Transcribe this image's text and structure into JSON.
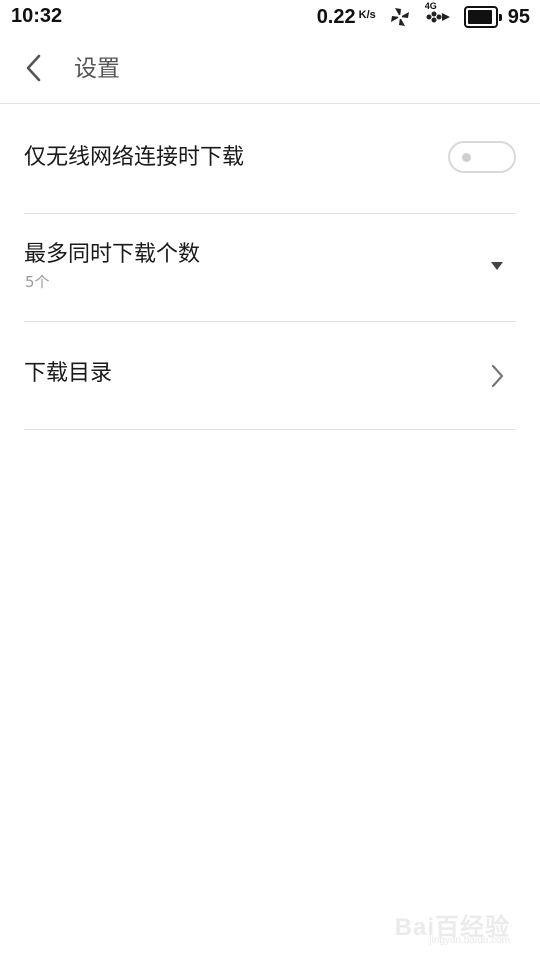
{
  "status_bar": {
    "time": "10:32",
    "net_speed": "0.22",
    "net_unit": "K/s",
    "network_type": "4G",
    "battery_level": "95",
    "battery_percent": 95,
    "icons": [
      "pinwheel-icon",
      "signal-4g-icon",
      "battery-icon"
    ]
  },
  "header": {
    "back_icon": "chevron-left-icon",
    "title": "设置"
  },
  "settings": [
    {
      "title": "仅无线网络连接时下载",
      "control": "toggle",
      "enabled": false
    },
    {
      "title": "最多同时下载个数",
      "subtitle": "5个",
      "control": "dropdown",
      "icon": "dropdown-triangle-icon"
    },
    {
      "title": "下载目录",
      "control": "chevron",
      "icon": "chevron-right-icon"
    }
  ],
  "watermark": {
    "text": "Bai百经验",
    "sub": "jingyan.baidu.com"
  },
  "colors": {
    "background": "#ffffff",
    "divider": "#e3e3e3",
    "text_primary": "#1a1a1a",
    "text_secondary": "#9a9a9a",
    "toggle_border": "#d9d9d9"
  }
}
